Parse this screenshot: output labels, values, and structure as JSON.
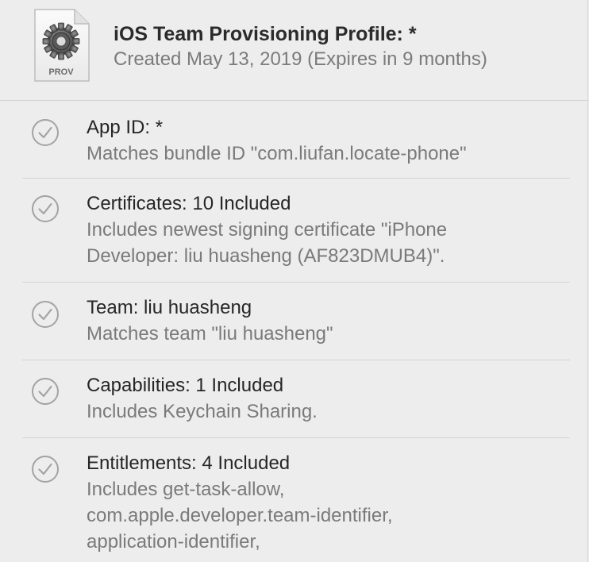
{
  "header": {
    "icon_label": "PROV",
    "title": "iOS Team Provisioning Profile: *",
    "subtitle": "Created May 13, 2019 (Expires in 9 months)"
  },
  "colors": {
    "background": "#ededed",
    "title_text": "#262626",
    "detail_text": "#7a7a7a",
    "check_icon": "#a3a3a3"
  },
  "rows": [
    {
      "icon": "checkmark-circle-icon",
      "title": "App ID: *",
      "detail_lines": [
        "Matches bundle ID \"com.liufan.locate-phone\""
      ]
    },
    {
      "icon": "checkmark-circle-icon",
      "title": "Certificates: 10 Included",
      "detail_lines": [
        "Includes newest signing certificate \"iPhone",
        "Developer: liu huasheng (AF823DMUB4)\"."
      ]
    },
    {
      "icon": "checkmark-circle-icon",
      "title": "Team: liu huasheng",
      "detail_lines": [
        "Matches team \"liu huasheng\""
      ]
    },
    {
      "icon": "checkmark-circle-icon",
      "title": "Capabilities: 1 Included",
      "detail_lines": [
        "Includes Keychain Sharing."
      ]
    },
    {
      "icon": "checkmark-circle-icon",
      "title": "Entitlements: 4 Included",
      "detail_lines": [
        "Includes get-task-allow,",
        "com.apple.developer.team-identifier,",
        "application-identifier,"
      ]
    }
  ]
}
